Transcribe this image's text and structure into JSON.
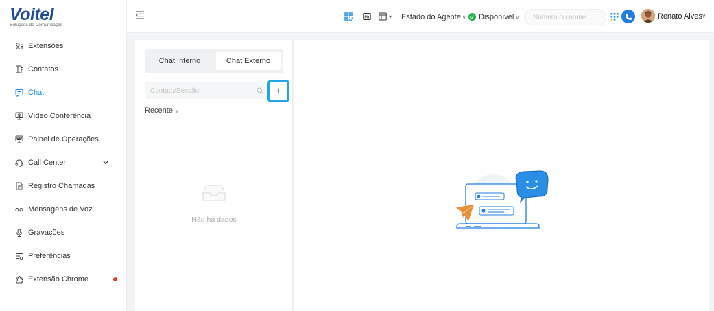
{
  "brand": {
    "name": "Voitel",
    "tagline": "Soluções de Comunicação"
  },
  "sidebar": {
    "items": [
      {
        "label": "Extensões",
        "icon": "extensions-icon"
      },
      {
        "label": "Contatos",
        "icon": "contacts-icon"
      },
      {
        "label": "Chat",
        "icon": "chat-icon",
        "active": true
      },
      {
        "label": "Vídeo Conferência",
        "icon": "video-conference-icon"
      },
      {
        "label": "Painel de Operações",
        "icon": "operations-panel-icon"
      },
      {
        "label": "Call Center",
        "icon": "headset-icon",
        "expandable": true
      },
      {
        "label": "Registro Chamadas",
        "icon": "call-log-icon"
      },
      {
        "label": "Mensagens de Voz",
        "icon": "voicemail-icon"
      },
      {
        "label": "Gravações",
        "icon": "microphone-icon"
      },
      {
        "label": "Preferências",
        "icon": "preferences-icon"
      },
      {
        "label": "Extensão Chrome",
        "icon": "chrome-extension-icon",
        "notification": true
      }
    ]
  },
  "header": {
    "agent_status_label": "Estado do Agente",
    "availability_label": "Disponível",
    "search_placeholder": "Número ou nome...",
    "user_name": "Renato Alves"
  },
  "chat": {
    "tabs": [
      "Chat Interno",
      "Chat Externo"
    ],
    "active_tab": "Chat Externo",
    "search_placeholder": "Contato/Sessão",
    "add_label": "+",
    "filter_label": "Recente",
    "empty_text": "Não há dados"
  },
  "colors": {
    "accent": "#1f8fdc",
    "brand": "#1d4f91",
    "status_green": "#23b04a",
    "highlight_border": "#20a6e6"
  }
}
